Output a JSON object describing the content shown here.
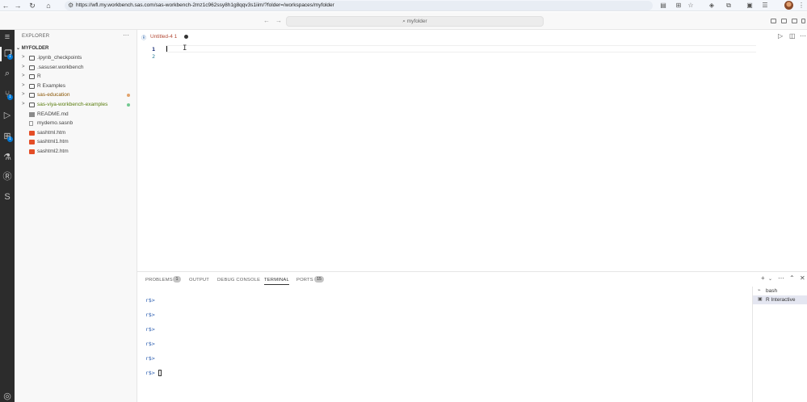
{
  "browser": {
    "url": "https://wfl.my.workbench.sas.com/sas-workbench-2mz1c962ssy8h1g8qqv3s1iim/?folder=/workspaces/myfolder",
    "back_icon": "arrow-left-icon",
    "forward_icon": "arrow-right-icon",
    "reload_icon": "reload-icon",
    "home_icon": "home-icon"
  },
  "titlebar": {
    "search": "myfolder"
  },
  "activity": {
    "scm_badge": "1",
    "extensions_badge": "1"
  },
  "explorer": {
    "title": "EXPLORER",
    "more": "···",
    "folder": "MYFOLDER",
    "items": [
      {
        "name": ".ipynb_checkpoints",
        "type": "folder",
        "status": ""
      },
      {
        "name": ".sasuser.workbench",
        "type": "folder",
        "status": ""
      },
      {
        "name": "R",
        "type": "folder",
        "status": ""
      },
      {
        "name": "R Examples",
        "type": "folder",
        "status": ""
      },
      {
        "name": "sas-education",
        "type": "folder",
        "status": "modified"
      },
      {
        "name": "sas-viya-workbench-examples",
        "type": "folder",
        "status": "untracked"
      },
      {
        "name": "README.md",
        "type": "md",
        "status": ""
      },
      {
        "name": "mydemo.sasnb",
        "type": "file",
        "status": ""
      },
      {
        "name": "sashtml.htm",
        "type": "html",
        "status": ""
      },
      {
        "name": "sashtml1.htm",
        "type": "html",
        "status": ""
      },
      {
        "name": "sashtml2.htm",
        "type": "html",
        "status": ""
      }
    ],
    "status_colors": {
      "modified": "#e2a36c",
      "untracked": "#73c991"
    }
  },
  "editor": {
    "tab_label": "Untitled-4 1",
    "line_numbers": [
      "1",
      "2"
    ]
  },
  "panel": {
    "tabs": {
      "problems": "PROBLEMS",
      "problems_count": "1",
      "output": "OUTPUT",
      "debug": "DEBUG CONSOLE",
      "terminal": "TERMINAL",
      "ports": "PORTS",
      "ports_count": "15"
    },
    "terminal_lines": [
      "r$>",
      "r$>",
      "r$>",
      "r$>",
      "r$>",
      "r$>"
    ],
    "terminals": [
      "bash",
      "R Interactive"
    ]
  }
}
